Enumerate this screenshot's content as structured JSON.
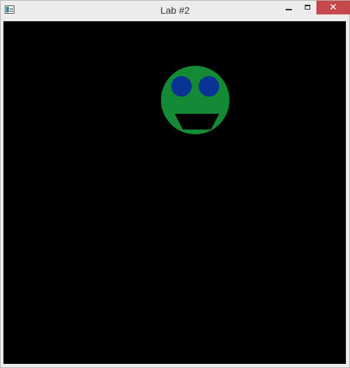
{
  "window": {
    "title": "Lab #2",
    "close_glyph": "✕"
  },
  "icons": {
    "app": "app-icon",
    "minimize": "minimize-icon",
    "maximize": "maximize-icon",
    "close": "close-icon"
  },
  "colors": {
    "canvas_background": "#000000",
    "face": "#138a33",
    "eyes": "#093394",
    "mouth": "#000000",
    "close_button": "#c7484b"
  }
}
